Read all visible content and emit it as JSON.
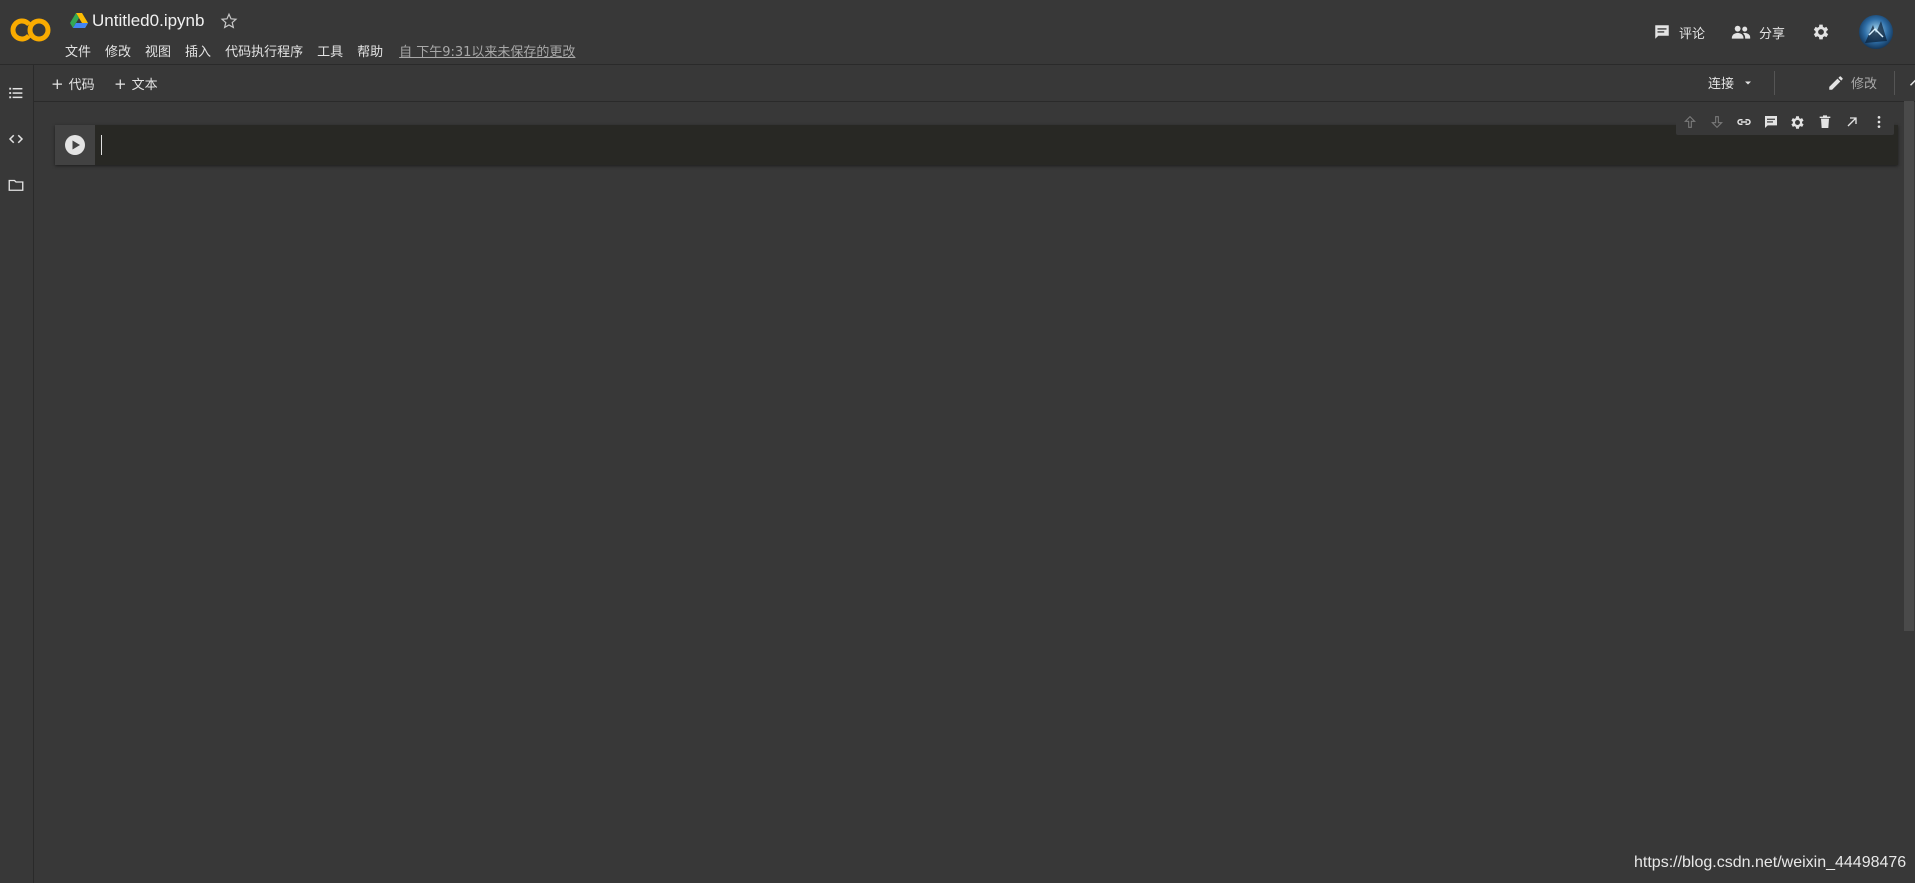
{
  "header": {
    "title": "Untitled0.ipynb",
    "menu": [
      "文件",
      "修改",
      "视图",
      "插入",
      "代码执行程序",
      "工具",
      "帮助"
    ],
    "save_status": "自 下午9:31以来未保存的更改",
    "comment_label": "评论",
    "share_label": "分享"
  },
  "toolbar": {
    "add_code_label": "代码",
    "add_text_label": "文本",
    "connect_label": "连接",
    "edit_label": "修改"
  },
  "cell": {
    "content": ""
  },
  "watermark": "https://blog.csdn.net/weixin_44498476",
  "colors": {
    "background": "#383838",
    "cell_background": "#282824",
    "logo_orange": "#f9ab00",
    "text": "#e3e3e3"
  },
  "icons": [
    "colab-logo",
    "drive-icon",
    "star-icon",
    "comment-icon",
    "share-icon",
    "gear-icon",
    "avatar",
    "toc-icon",
    "code-snippets-icon",
    "folder-icon",
    "plus-icon",
    "chevron-down-icon",
    "pencil-icon",
    "chevron-up-icon",
    "play-icon",
    "arrow-up-icon",
    "arrow-down-icon",
    "link-icon",
    "comment-icon",
    "gear-icon",
    "delete-icon",
    "open-in-tab-icon",
    "more-vert-icon"
  ]
}
